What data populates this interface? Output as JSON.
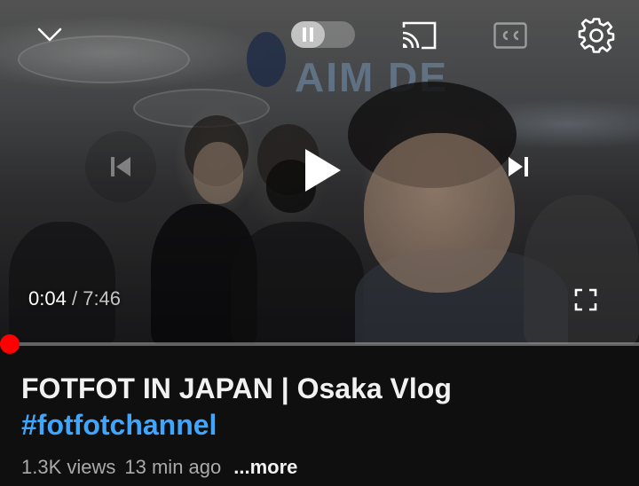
{
  "player": {
    "current_time": "0:04",
    "separator": "/",
    "duration": "7:46",
    "progress_fraction": 0.009,
    "background_sign_text": "AIM DE",
    "colors": {
      "progress": "#ff0000",
      "track": "rgba(255,255,255,0.35)"
    },
    "icons": {
      "collapse": "chevron-down-icon",
      "autoplay": "autoplay-pause-toggle-icon",
      "cast": "cast-icon",
      "captions": "closed-captions-icon",
      "settings": "gear-icon",
      "previous": "skip-previous-icon",
      "play": "play-icon",
      "next": "skip-next-icon",
      "fullscreen": "fullscreen-icon"
    }
  },
  "video": {
    "title": "FOTFOT IN JAPAN | Osaka Vlog",
    "hashtag": "#fotfotchannel",
    "views": "1.3K views",
    "age": "13 min ago",
    "more_label": "...more"
  },
  "colors": {
    "background": "#0f0f0f",
    "link": "#3ea6ff",
    "secondary_text": "#aaaaaa"
  }
}
